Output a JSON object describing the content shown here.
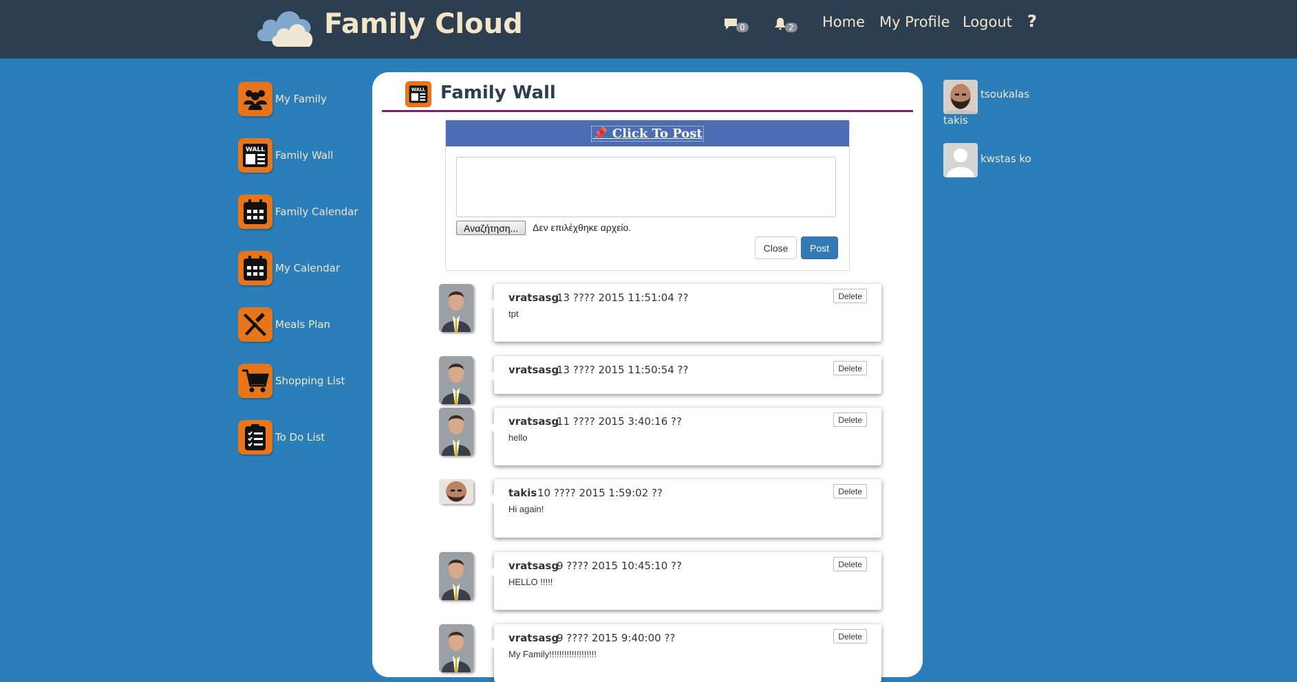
{
  "header": {
    "brand": "Family Cloud",
    "messages_count": "0",
    "notifications_count": "2",
    "nav": [
      "Home",
      "My Profile",
      "Logout",
      "?"
    ]
  },
  "sidebar": {
    "items": [
      {
        "label": "My Family",
        "icon": "family-icon"
      },
      {
        "label": "Family Wall",
        "icon": "wall-icon"
      },
      {
        "label": "Family Calendar",
        "icon": "calendar-icon"
      },
      {
        "label": "My Calendar",
        "icon": "calendar-icon"
      },
      {
        "label": "Meals Plan",
        "icon": "meals-icon"
      },
      {
        "label": "Shopping List",
        "icon": "cart-icon"
      },
      {
        "label": "To Do List",
        "icon": "todo-icon"
      }
    ]
  },
  "main": {
    "title": "Family Wall",
    "composer": {
      "header": "📌 Click To Post",
      "textarea_value": "",
      "browse_label": "Αναζήτηση...",
      "no_file_text": "Δεν επιλέχθηκε αρχείο.",
      "close_label": "Close",
      "post_label": "Post"
    },
    "delete_label": "Delete",
    "posts": [
      {
        "author": "vratsasg",
        "date": "13 ???? 2015 11:51:04 ??",
        "text": "tpt"
      },
      {
        "author": "vratsasg",
        "date": "13 ???? 2015 11:50:54 ??",
        "text": ""
      },
      {
        "author": "vratsasg",
        "date": "11 ???? 2015 3:40:16 ??",
        "text": "hello"
      },
      {
        "author": "takis",
        "date": "10 ???? 2015 1:59:02 ??",
        "text": "Hi again!"
      },
      {
        "author": "vratsasg",
        "date": "9 ???? 2015 10:45:10 ??",
        "text": "HELLO !!!!!"
      },
      {
        "author": "vratsasg",
        "date": "9 ???? 2015 9:40:00 ??",
        "text": "My Family!!!!!!!!!!!!!!!!!!!"
      }
    ]
  },
  "members": [
    {
      "name": "tsoukalas",
      "subname": "takis"
    },
    {
      "name": "kwstas ko"
    }
  ],
  "colors": {
    "topbar": "#2c3e50",
    "background": "#2a7fba",
    "accent_orange": "#e8751a",
    "brand_text": "#f3e6c8",
    "post_button": "#337ab7",
    "composer_header": "#4a6db5",
    "title_rule": "#7a1f6e"
  }
}
